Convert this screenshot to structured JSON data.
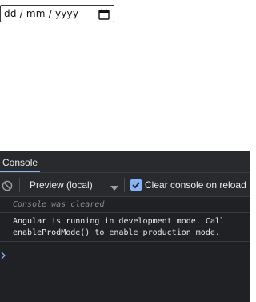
{
  "page": {
    "date_input": {
      "placeholder": "dd / mm / yyyy",
      "icon": "calendar-icon"
    }
  },
  "devtools": {
    "tabs": [
      {
        "label": "Console",
        "active": true
      }
    ],
    "toolbar": {
      "clear_icon": "clear-console-icon",
      "context": "Preview (local)",
      "dropdown_icon": "dropdown-arrow-icon",
      "clear_on_reload": {
        "label": "Clear console on reload",
        "checked": true
      }
    },
    "messages": [
      {
        "type": "info",
        "text": "Console was cleared"
      },
      {
        "type": "log",
        "text": "Angular is running in development mode. Call\nenableProdMode() to enable production mode."
      }
    ],
    "prompt_icon": "prompt-chevron-icon"
  },
  "colors": {
    "accent": "#8ab4f8",
    "panel_bg": "#202124",
    "toolbar_bg": "#292a2d"
  }
}
